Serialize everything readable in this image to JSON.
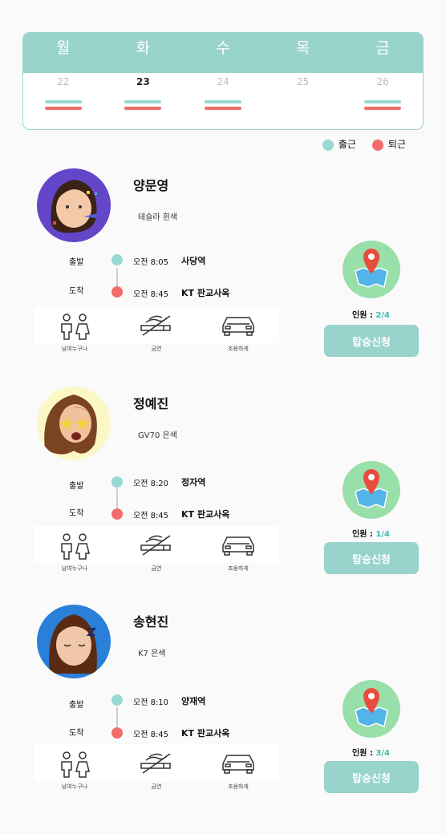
{
  "calendar": {
    "days": [
      "월",
      "화",
      "수",
      "목",
      "금"
    ],
    "dates": [
      "22",
      "23",
      "24",
      "25",
      "26"
    ],
    "today_index": 1,
    "commute_days": [
      true,
      true,
      true,
      false,
      true
    ]
  },
  "legend": {
    "in_label": "출근",
    "out_label": "퇴근",
    "in_color": "#9ad8d2",
    "out_color": "#f26c6c"
  },
  "cards": [
    {
      "name": "양문영",
      "car": "테슬라 흰색",
      "depart_label": "출발",
      "depart_time": "오전 8:05",
      "depart_place": "사당역",
      "arrive_label": "도착",
      "arrive_time": "오전 8:45",
      "arrive_place": "KT 판교사옥",
      "amenities": [
        "남여누구나",
        "금연",
        "조용하게"
      ],
      "count_label": "인원 : ",
      "count_value": "2/4",
      "button": "탑승신청",
      "avatar_bg": "#6446c9"
    },
    {
      "name": "정예진",
      "car": "GV70 은색",
      "depart_label": "출발",
      "depart_time": "오전 8:20",
      "depart_place": "정자역",
      "arrive_label": "도착",
      "arrive_time": "오전 8:45",
      "arrive_place": "KT 판교사옥",
      "amenities": [
        "남여누구나",
        "금연",
        "조용하게"
      ],
      "count_label": "인원 : ",
      "count_value": "1/4",
      "button": "탑승신청",
      "avatar_bg": "#fbf8c6"
    },
    {
      "name": "송현진",
      "car": "K7 은색",
      "depart_label": "출발",
      "depart_time": "오전 8:10",
      "depart_place": "양재역",
      "arrive_label": "도착",
      "arrive_time": "오전 8:45",
      "arrive_place": "KT 판교사옥",
      "amenities": [
        "남여누구나",
        "금연",
        "조용하게"
      ],
      "count_label": "인원 : ",
      "count_value": "3/4",
      "button": "탑승신청",
      "avatar_bg": "#2a7fd9"
    }
  ]
}
